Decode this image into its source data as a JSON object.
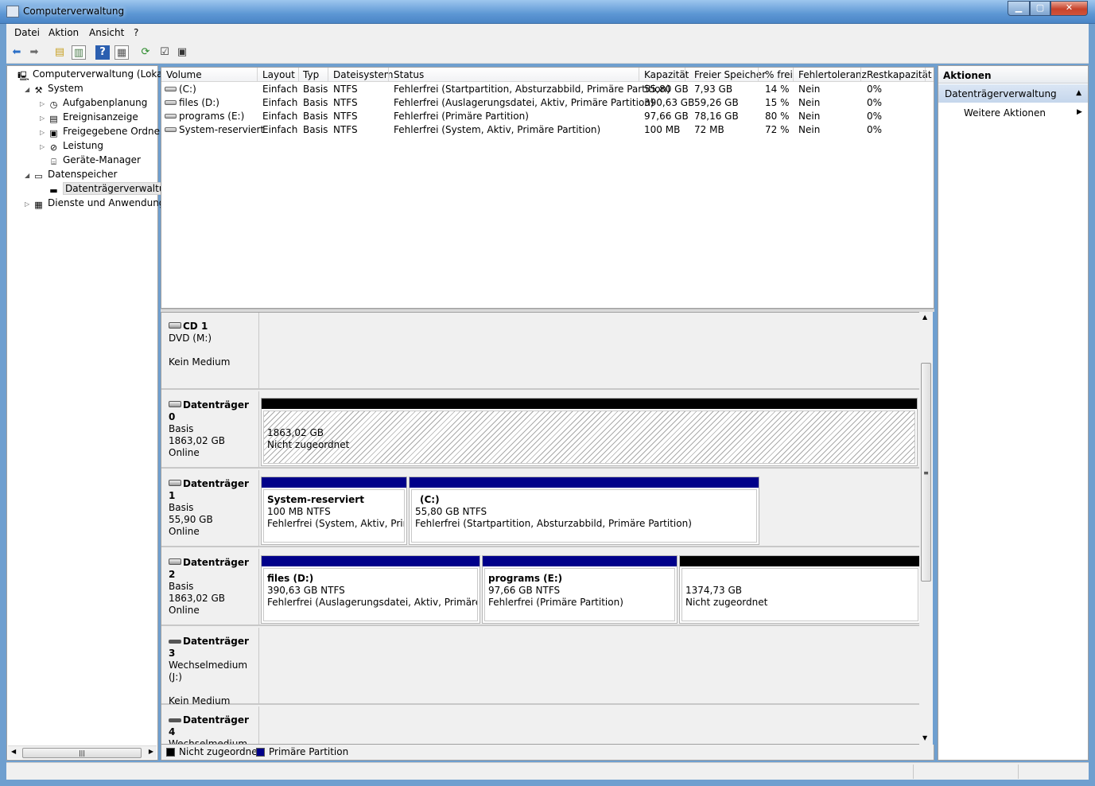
{
  "window": {
    "title": "Computerverwaltung"
  },
  "menu": [
    "Datei",
    "Aktion",
    "Ansicht",
    "?"
  ],
  "tree": [
    {
      "label": "Computerverwaltung (Lokal)",
      "icon": "computer-icon",
      "indent": 0,
      "exp": ""
    },
    {
      "label": "System",
      "icon": "tools-icon",
      "indent": 1,
      "exp": "◢"
    },
    {
      "label": "Aufgabenplanung",
      "icon": "clock-icon",
      "indent": 2,
      "exp": "▷"
    },
    {
      "label": "Ereignisanzeige",
      "icon": "event-log-icon",
      "indent": 2,
      "exp": "▷"
    },
    {
      "label": "Freigegebene Ordner",
      "icon": "shared-folder-icon",
      "indent": 2,
      "exp": "▷"
    },
    {
      "label": "Leistung",
      "icon": "performance-icon",
      "indent": 2,
      "exp": "▷"
    },
    {
      "label": "Geräte-Manager",
      "icon": "device-manager-icon",
      "indent": 2,
      "exp": ""
    },
    {
      "label": "Datenspeicher",
      "icon": "storage-icon",
      "indent": 1,
      "exp": "◢"
    },
    {
      "label": "Datenträgerverwaltung",
      "icon": "disk-management-icon",
      "indent": 2,
      "exp": "",
      "selected": true
    },
    {
      "label": "Dienste und Anwendungen",
      "icon": "services-icon",
      "indent": 1,
      "exp": "▷"
    }
  ],
  "volumes": {
    "columns": [
      "Volume",
      "Layout",
      "Typ",
      "Dateisystem",
      "Status",
      "Kapazität",
      "Freier Speicher",
      "% frei",
      "Fehlertoleranz",
      "Restkapazität"
    ],
    "rows": [
      [
        "(C:)",
        "Einfach",
        "Basis",
        "NTFS",
        "Fehlerfrei (Startpartition, Absturzabbild, Primäre Partition)",
        "55,80 GB",
        "7,93 GB",
        "14 %",
        "Nein",
        "0%"
      ],
      [
        "files (D:)",
        "Einfach",
        "Basis",
        "NTFS",
        "Fehlerfrei (Auslagerungsdatei, Aktiv, Primäre Partition)",
        "390,63 GB",
        "59,26 GB",
        "15 %",
        "Nein",
        "0%"
      ],
      [
        "programs (E:)",
        "Einfach",
        "Basis",
        "NTFS",
        "Fehlerfrei (Primäre Partition)",
        "97,66 GB",
        "78,16 GB",
        "80 %",
        "Nein",
        "0%"
      ],
      [
        "System-reserviert",
        "Einfach",
        "Basis",
        "NTFS",
        "Fehlerfrei (System, Aktiv, Primäre Partition)",
        "100 MB",
        "72 MB",
        "72 %",
        "Nein",
        "0%"
      ]
    ]
  },
  "disks": [
    {
      "name": "CD 1",
      "lines": [
        "DVD (M:)",
        "",
        "Kein Medium"
      ],
      "kind": "cd"
    },
    {
      "name": "Datenträger 0",
      "lines": [
        "Basis",
        "1863,02 GB",
        "Online"
      ],
      "kind": "disk"
    },
    {
      "name": "Datenträger 1",
      "lines": [
        "Basis",
        "55,90 GB",
        "Online"
      ],
      "kind": "disk"
    },
    {
      "name": "Datenträger 2",
      "lines": [
        "Basis",
        "1863,02 GB",
        "Online"
      ],
      "kind": "disk"
    },
    {
      "name": "Datenträger 3",
      "lines": [
        "Wechselmedium (J:)",
        "",
        "Kein Medium"
      ],
      "kind": "removable"
    },
    {
      "name": "Datenträger 4",
      "lines": [
        "Wechselmedium (K:"
      ],
      "kind": "removable"
    }
  ],
  "partitions": [
    [],
    [
      {
        "title": "",
        "size": "1863,02 GB",
        "status": "Nicht zugeordnet",
        "type": "unallocated",
        "w": 826
      }
    ],
    [
      {
        "title": "System-reserviert",
        "size": "100 MB NTFS",
        "status": "Fehlerfrei (System, Aktiv, Primär",
        "type": "primary",
        "w": 184
      },
      {
        "title": "(C:)",
        "size": "55,80 GB NTFS",
        "status": "Fehlerfrei (Startpartition, Absturzabbild, Primäre Partition)",
        "type": "primary",
        "w": 441
      }
    ],
    [
      {
        "title": "files  (D:)",
        "size": "390,63 GB NTFS",
        "status": "Fehlerfrei (Auslagerungsdatei, Aktiv, Primäre Parti",
        "type": "primary",
        "w": 276
      },
      {
        "title": "programs  (E:)",
        "size": "97,66 GB NTFS",
        "status": "Fehlerfrei (Primäre Partition)",
        "type": "primary",
        "w": 246
      },
      {
        "title": "",
        "size": "1374,73 GB",
        "status": "Nicht zugeordnet",
        "type": "unallocated",
        "w": 304
      }
    ],
    [],
    []
  ],
  "legend": {
    "unallocated": "Nicht zugeordnet",
    "primary": "Primäre Partition",
    "colors": {
      "unallocated": "#000000",
      "primary": "#00008a"
    }
  },
  "actions": {
    "header": "Aktionen",
    "section": "Datenträgerverwaltung",
    "more": "Weitere Aktionen"
  }
}
